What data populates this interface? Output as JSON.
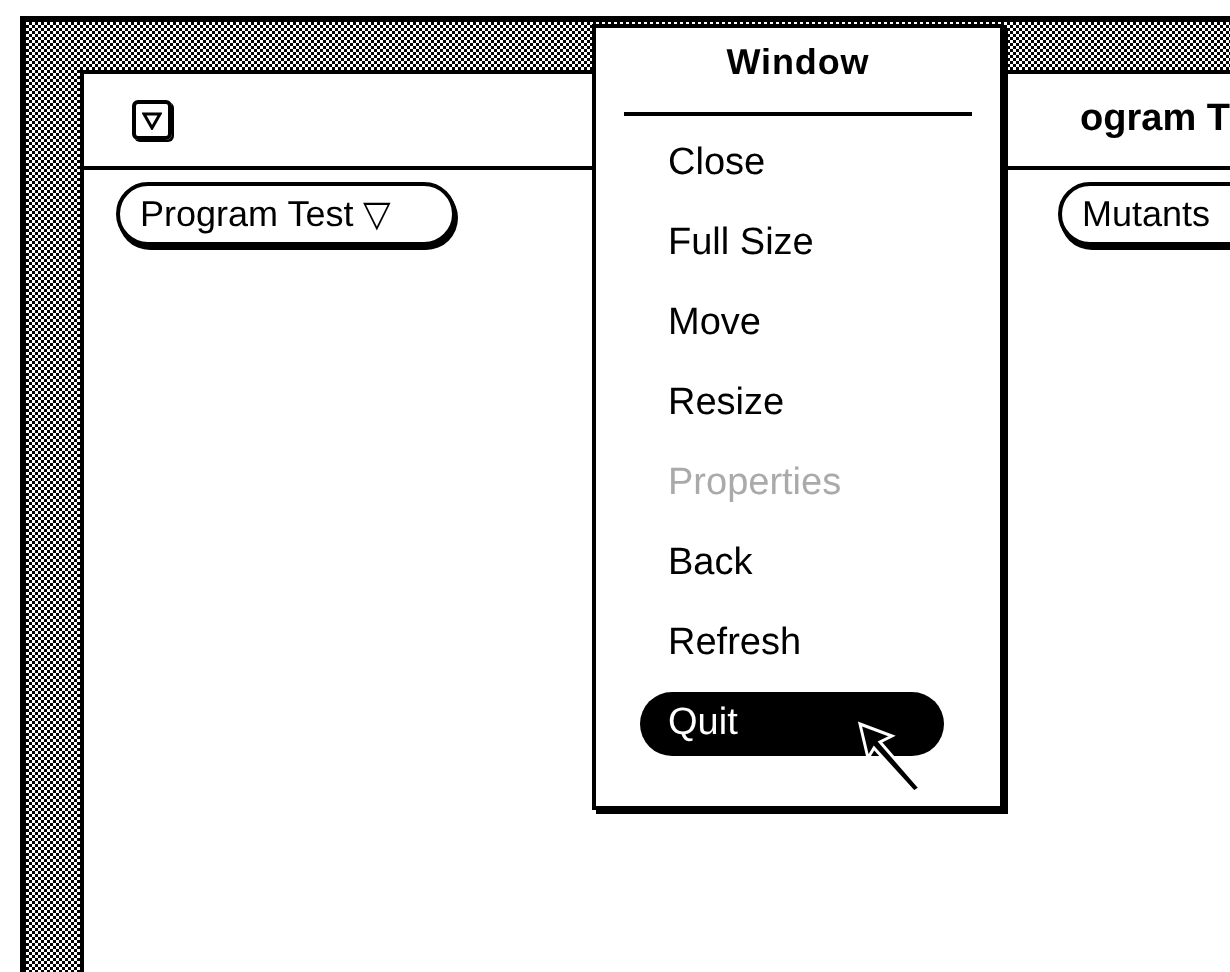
{
  "window": {
    "title": "ogram T"
  },
  "buttons": [
    {
      "label": "Program Test ▽"
    },
    {
      "label": "Mutants"
    }
  ],
  "menu": {
    "title": "Window",
    "items": [
      {
        "label": "Close",
        "selected": false,
        "disabled": false
      },
      {
        "label": "Full Size",
        "selected": false,
        "disabled": false
      },
      {
        "label": "Move",
        "selected": false,
        "disabled": false
      },
      {
        "label": "Resize",
        "selected": false,
        "disabled": false
      },
      {
        "label": "Properties",
        "selected": false,
        "disabled": true
      },
      {
        "label": "Back",
        "selected": false,
        "disabled": false
      },
      {
        "label": "Refresh",
        "selected": false,
        "disabled": false
      },
      {
        "label": "Quit",
        "selected": true,
        "disabled": false
      }
    ]
  }
}
